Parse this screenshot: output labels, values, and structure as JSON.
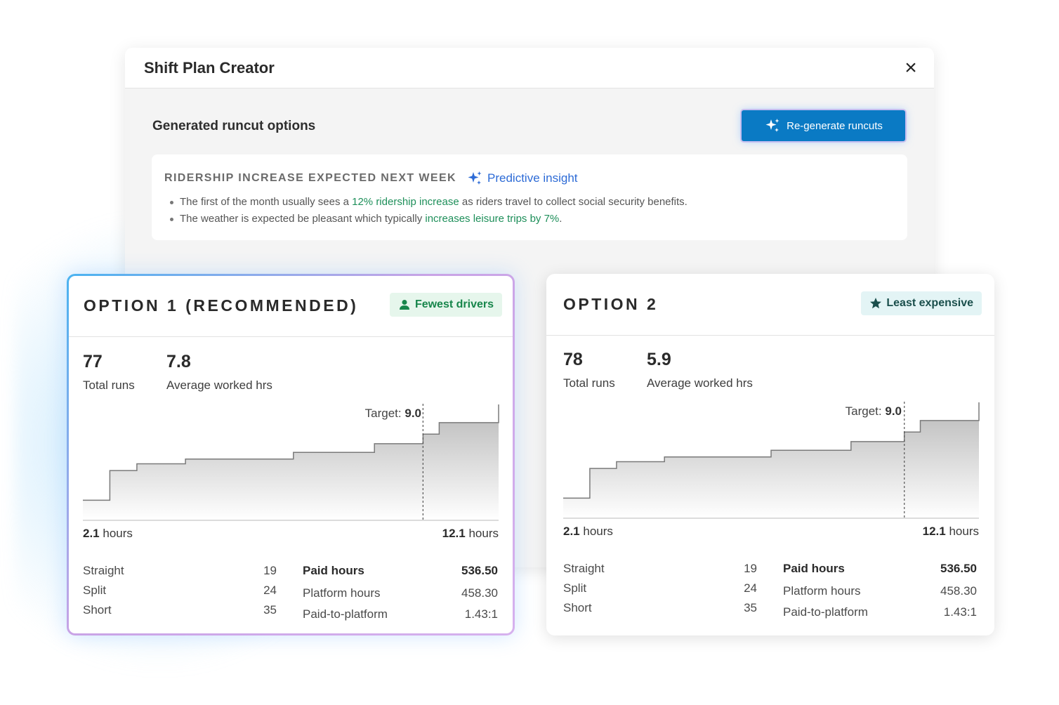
{
  "modal": {
    "title": "Shift Plan Creator",
    "close_icon": "×",
    "section_title": "Generated runcut options",
    "regen_label": "Re-generate runcuts"
  },
  "insight": {
    "title": "RIDERSHIP INCREASE EXPECTED NEXT WEEK",
    "predictive_label": "Predictive insight",
    "bullets": [
      {
        "before": "The first of the month usually sees a ",
        "highlight": "12% ridership increase",
        "after": " as riders travel to collect social security benefits."
      },
      {
        "before": "The weather is expected be pleasant which typically ",
        "highlight": "increases leisure trips by 7%",
        "after": "."
      }
    ]
  },
  "options": [
    {
      "title": "OPTION 1 (RECOMMENDED)",
      "badge": "Fewest drivers",
      "badge_icon": "person-icon",
      "total_runs": "77",
      "total_runs_label": "Total runs",
      "avg_hrs": "7.8",
      "avg_hrs_label": "Average worked hrs",
      "target_label": "Target:",
      "target_value": "9.0",
      "min_value": "2.1",
      "max_value": "12.1",
      "hours_unit": "hours",
      "straight_label": "Straight",
      "straight": "19",
      "split_label": "Split",
      "split": "24",
      "short_label": "Short",
      "short": "35",
      "paid_label": "Paid hours",
      "paid": "536.50",
      "platform_label": "Platform hours",
      "platform": "458.30",
      "ratio_label": "Paid-to-platform",
      "ratio": "1.43:1"
    },
    {
      "title": "OPTION 2",
      "badge": "Least expensive",
      "badge_icon": "star-icon",
      "total_runs": "78",
      "total_runs_label": "Total runs",
      "avg_hrs": "5.9",
      "avg_hrs_label": "Average worked hrs",
      "target_label": "Target:",
      "target_value": "9.0",
      "min_value": "2.1",
      "max_value": "12.1",
      "hours_unit": "hours",
      "straight_label": "Straight",
      "straight": "19",
      "split_label": "Split",
      "split": "24",
      "short_label": "Short",
      "short": "35",
      "paid_label": "Paid hours",
      "paid": "536.50",
      "platform_label": "Platform hours",
      "platform": "458.30",
      "ratio_label": "Paid-to-platform",
      "ratio": "1.43:1"
    }
  ],
  "chart_data": [
    {
      "type": "area",
      "step": true,
      "xlim": [
        0,
        77
      ],
      "ylim": [
        0,
        12.1
      ],
      "target": 9.0,
      "x": [
        0,
        5,
        10,
        19,
        39,
        54,
        63,
        66,
        77
      ],
      "y": [
        2.1,
        5.2,
        5.9,
        6.4,
        7.1,
        8.0,
        9.0,
        10.2,
        12.1
      ]
    },
    {
      "type": "area",
      "step": true,
      "xlim": [
        0,
        78
      ],
      "ylim": [
        0,
        12.1
      ],
      "target": 9.0,
      "x": [
        0,
        5,
        10,
        19,
        39,
        54,
        64,
        67,
        78
      ],
      "y": [
        2.1,
        5.2,
        5.9,
        6.4,
        7.1,
        8.0,
        9.0,
        10.2,
        12.1
      ]
    }
  ],
  "colors": {
    "accent": "#0a7ac4",
    "highlight": "#1e8f5a",
    "predictive": "#2d6bd6",
    "badge_green": "#17864b",
    "badge_teal": "#1a4f4c"
  }
}
